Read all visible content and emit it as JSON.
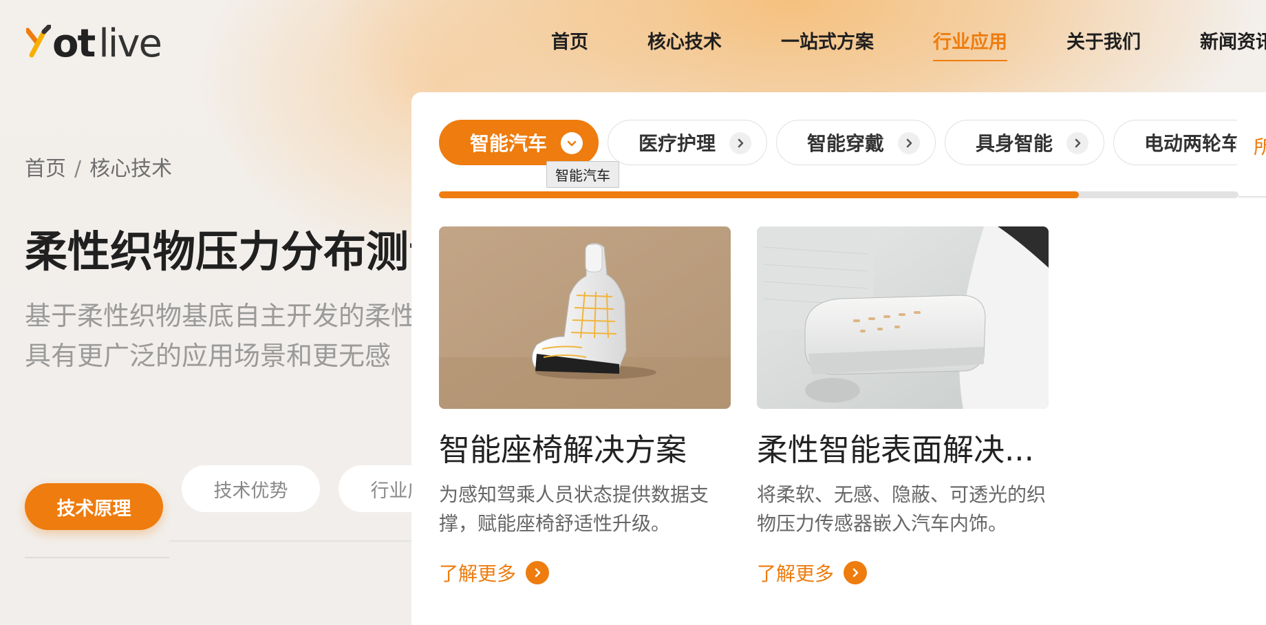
{
  "header": {
    "logo_text_bold": "ot",
    "logo_text_light": "live",
    "nav": [
      {
        "label": "首页",
        "active": false
      },
      {
        "label": "核心技术",
        "active": false
      },
      {
        "label": "一站式方案",
        "active": false
      },
      {
        "label": "行业应用",
        "active": true
      },
      {
        "label": "关于我们",
        "active": false
      },
      {
        "label": "新闻资讯",
        "active": false
      }
    ]
  },
  "hero": {
    "breadcrumb": {
      "home": "首页",
      "separator": "/",
      "current": "核心技术"
    },
    "title": "柔性织物压力分布测试",
    "desc_line1": "基于柔性织物基底自主开发的柔性",
    "desc_line2": "具有更广泛的应用场景和更无感",
    "tabs": {
      "primary": "技术原理",
      "second": "技术优势",
      "third": "行业应用"
    }
  },
  "dropdown": {
    "categories": [
      {
        "label": "智能汽车",
        "active": true
      },
      {
        "label": "医疗护理",
        "active": false
      },
      {
        "label": "智能穿戴",
        "active": false
      },
      {
        "label": "具身智能",
        "active": false
      },
      {
        "label": "电动两轮车",
        "active": false
      }
    ],
    "more_label": "所",
    "tooltip": "智能汽车",
    "scroll_progress": 0.8,
    "cards": [
      {
        "title": "智能座椅解决方案",
        "desc": "为感知驾乘人员状态提供数据支撑，赋能座椅舒适性升级。",
        "more": "了解更多"
      },
      {
        "title": "柔性智能表面解决...",
        "desc": "将柔软、无感、隐蔽、可透光的织物压力传感器嵌入汽车内饰。",
        "more": "了解更多"
      }
    ]
  },
  "colors": {
    "accent": "#ee7c0e",
    "text": "#222222",
    "muted": "#9a9a9a"
  }
}
